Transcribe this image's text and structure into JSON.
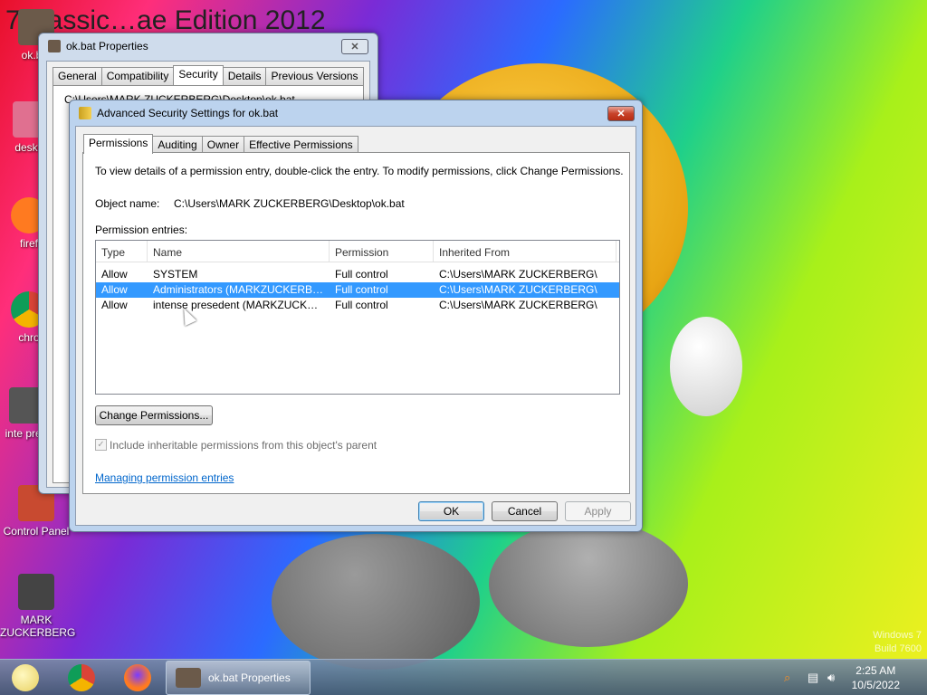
{
  "desktop": {
    "background_title": "7…assic…ae Edition 2012",
    "os_badge_line1": "Windows 7",
    "os_badge_line2": "Build 7600",
    "icons": [
      {
        "label": "ok.bat"
      },
      {
        "label": "deskto"
      },
      {
        "label": "firef"
      },
      {
        "label": "chro"
      },
      {
        "label": "inte presi"
      },
      {
        "label": "Control Panel"
      },
      {
        "label": "MARK ZUCKERBERG"
      }
    ]
  },
  "properties_window": {
    "title": "ok.bat Properties",
    "tabs": [
      "General",
      "Compatibility",
      "Security",
      "Details",
      "Previous Versions"
    ],
    "selected_tab": "Security",
    "object_name_partial": "C:\\Users\\MARK ZUCKERBERG\\Desktop\\ok.bat"
  },
  "advanced_window": {
    "title": "Advanced Security Settings for ok.bat",
    "tabs": [
      "Permissions",
      "Auditing",
      "Owner",
      "Effective Permissions"
    ],
    "selected_tab": "Permissions",
    "instructions": "To view details of a permission entry, double-click the entry. To modify permissions, click Change Permissions.",
    "object_name_label": "Object name:",
    "object_name_value": "C:\\Users\\MARK ZUCKERBERG\\Desktop\\ok.bat",
    "entries_label": "Permission entries:",
    "columns": [
      "Type",
      "Name",
      "Permission",
      "Inherited From"
    ],
    "rows": [
      {
        "type": "Allow",
        "name": "SYSTEM",
        "permission": "Full control",
        "inherited": "C:\\Users\\MARK ZUCKERBERG\\"
      },
      {
        "type": "Allow",
        "name": "Administrators (MARKZUCKERBERG...",
        "permission": "Full control",
        "inherited": "C:\\Users\\MARK ZUCKERBERG\\"
      },
      {
        "type": "Allow",
        "name": "intense presedent (MARKZUCKERBE...",
        "permission": "Full control",
        "inherited": "C:\\Users\\MARK ZUCKERBERG\\"
      }
    ],
    "selected_row": 1,
    "change_button": "Change Permissions...",
    "inherit_checkbox_label": "Include inheritable permissions from this object's parent",
    "inherit_checked": true,
    "help_link": "Managing permission entries",
    "ok_button": "OK",
    "cancel_button": "Cancel",
    "apply_button": "Apply"
  },
  "taskbar": {
    "active_app_label": "ok.bat Properties",
    "time": "2:25 AM",
    "date": "10/5/2022"
  },
  "colors": {
    "selection": "#3399ff",
    "link": "#0066cc",
    "close_active": "#c8432a"
  }
}
